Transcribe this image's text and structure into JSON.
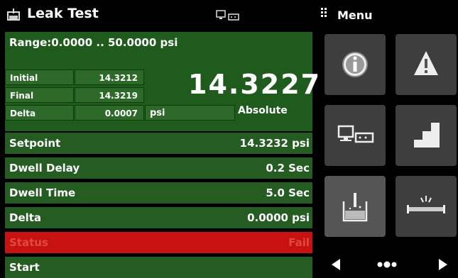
{
  "header": {
    "title": "Leak Test",
    "menu_label": "Menu"
  },
  "range_label": "Range:0.0000 .. 50.0000 psi",
  "results": {
    "initial_label": "Initial",
    "initial_value": "14.3212",
    "final_label": "Final",
    "final_value": "14.3219",
    "delta_label": "Delta",
    "delta_value": "0.0007"
  },
  "reading": {
    "value": "14.3227",
    "unit": "psi",
    "mode": "Absolute"
  },
  "params": [
    {
      "label": "Setpoint",
      "value": "14.3232 psi"
    },
    {
      "label": "Dwell Delay",
      "value": "0.2 Sec"
    },
    {
      "label": "Dwell Time",
      "value": "5.0 Sec"
    },
    {
      "label": "Delta",
      "value": "0.0000 psi"
    },
    {
      "label": "Status",
      "value": "Fail"
    },
    {
      "label": "Start",
      "value": ""
    }
  ],
  "menu_tiles": [
    {
      "icon": "info-icon"
    },
    {
      "icon": "warning-icon"
    },
    {
      "icon": "remote-display-icon"
    },
    {
      "icon": "step-icon"
    },
    {
      "icon": "leak-test-icon"
    },
    {
      "icon": "burst-test-icon"
    }
  ],
  "colors": {
    "panel_green": "#1f5b1c",
    "row_green": "#245c21",
    "status_red": "#c81212",
    "tile_gray": "#3e3e3e"
  }
}
